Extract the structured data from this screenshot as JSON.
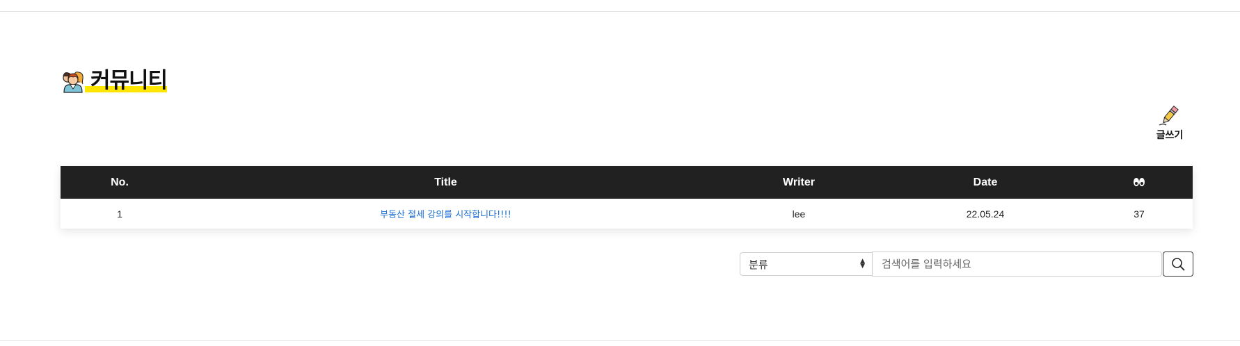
{
  "page": {
    "title": "커뮤니티"
  },
  "toolbar": {
    "write_label": "글쓰기"
  },
  "table": {
    "columns": [
      "No.",
      "Title",
      "Writer",
      "Date"
    ],
    "rows": [
      {
        "no": "1",
        "title": "부동산 절세 강의를 시작합니다!!!!",
        "writer": "lee",
        "date": "22.05.24",
        "views": "37"
      }
    ]
  },
  "search": {
    "category_selected": "분류",
    "placeholder": "검색어를 입력하세요"
  },
  "colors": {
    "header_bg": "#212121",
    "title_highlight": "#ffe600",
    "link": "#1a6fd1"
  },
  "icons": {
    "title": "people-icon",
    "write": "pencil-icon",
    "views": "eyes-icon",
    "search": "search-icon"
  }
}
